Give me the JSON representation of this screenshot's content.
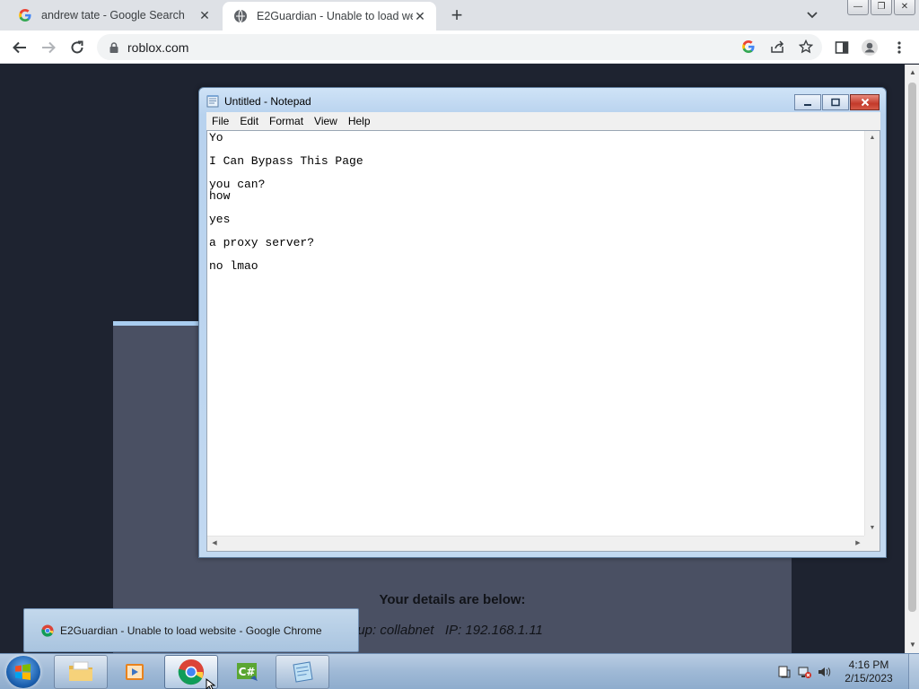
{
  "chrome": {
    "tabs": [
      {
        "title": "andrew tate - Google Search",
        "active": false
      },
      {
        "title": "E2Guardian - Unable to load website - Google Chrome",
        "active": true
      }
    ],
    "url": "roblox.com",
    "close_glyph": "✕",
    "new_tab_glyph": "+"
  },
  "page": {
    "details_title": "Your details are below:",
    "details_line": "oup: collabnet   IP: 192.168.1.11"
  },
  "notepad": {
    "title": "Untitled - Notepad",
    "menu": [
      "File",
      "Edit",
      "Format",
      "View",
      "Help"
    ],
    "lines": [
      "Yo",
      "",
      "I Can Bypass This Page",
      "",
      "you can?",
      "how",
      "",
      "yes",
      "",
      "a proxy server?",
      "",
      "no lmao"
    ]
  },
  "taskbar": {
    "preview_title": "E2Guardian - Unable to load website - Google Chrome",
    "clock_time": "4:16 PM",
    "clock_date": "2/15/2023",
    "buttons": [
      "explorer-icon",
      "media-player-icon",
      "chrome-icon",
      "csharp-icon",
      "notepad-icon"
    ]
  },
  "colors": {
    "page_bg": "#1e2330",
    "panel": "#4a5063",
    "panel_accent": "#a9cdf0"
  }
}
